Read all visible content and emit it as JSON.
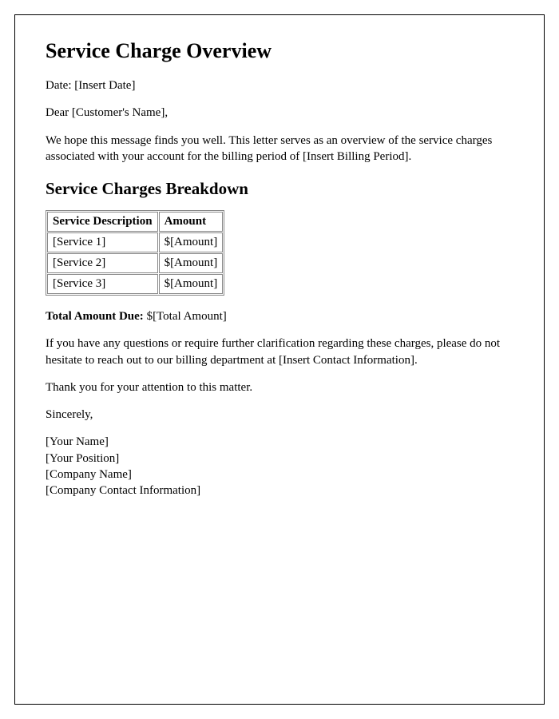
{
  "title": "Service Charge Overview",
  "date_line": "Date: [Insert Date]",
  "greeting": "Dear [Customer's Name],",
  "intro": "We hope this message finds you well. This letter serves as an overview of the service charges associated with your account for the billing period of [Insert Billing Period].",
  "breakdown_heading": "Service Charges Breakdown",
  "table": {
    "headers": [
      "Service Description",
      "Amount"
    ],
    "rows": [
      [
        "[Service 1]",
        "$[Amount]"
      ],
      [
        "[Service 2]",
        "$[Amount]"
      ],
      [
        "[Service 3]",
        "$[Amount]"
      ]
    ]
  },
  "total_label": "Total Amount Due:",
  "total_value": "$[Total Amount]",
  "questions": "If you have any questions or require further clarification regarding these charges, please do not hesitate to reach out to our billing department at [Insert Contact Information].",
  "thanks": "Thank you for your attention to this matter.",
  "signoff": "Sincerely,",
  "signature": {
    "name": "[Your Name]",
    "position": "[Your Position]",
    "company": "[Company Name]",
    "contact": "[Company Contact Information]"
  }
}
